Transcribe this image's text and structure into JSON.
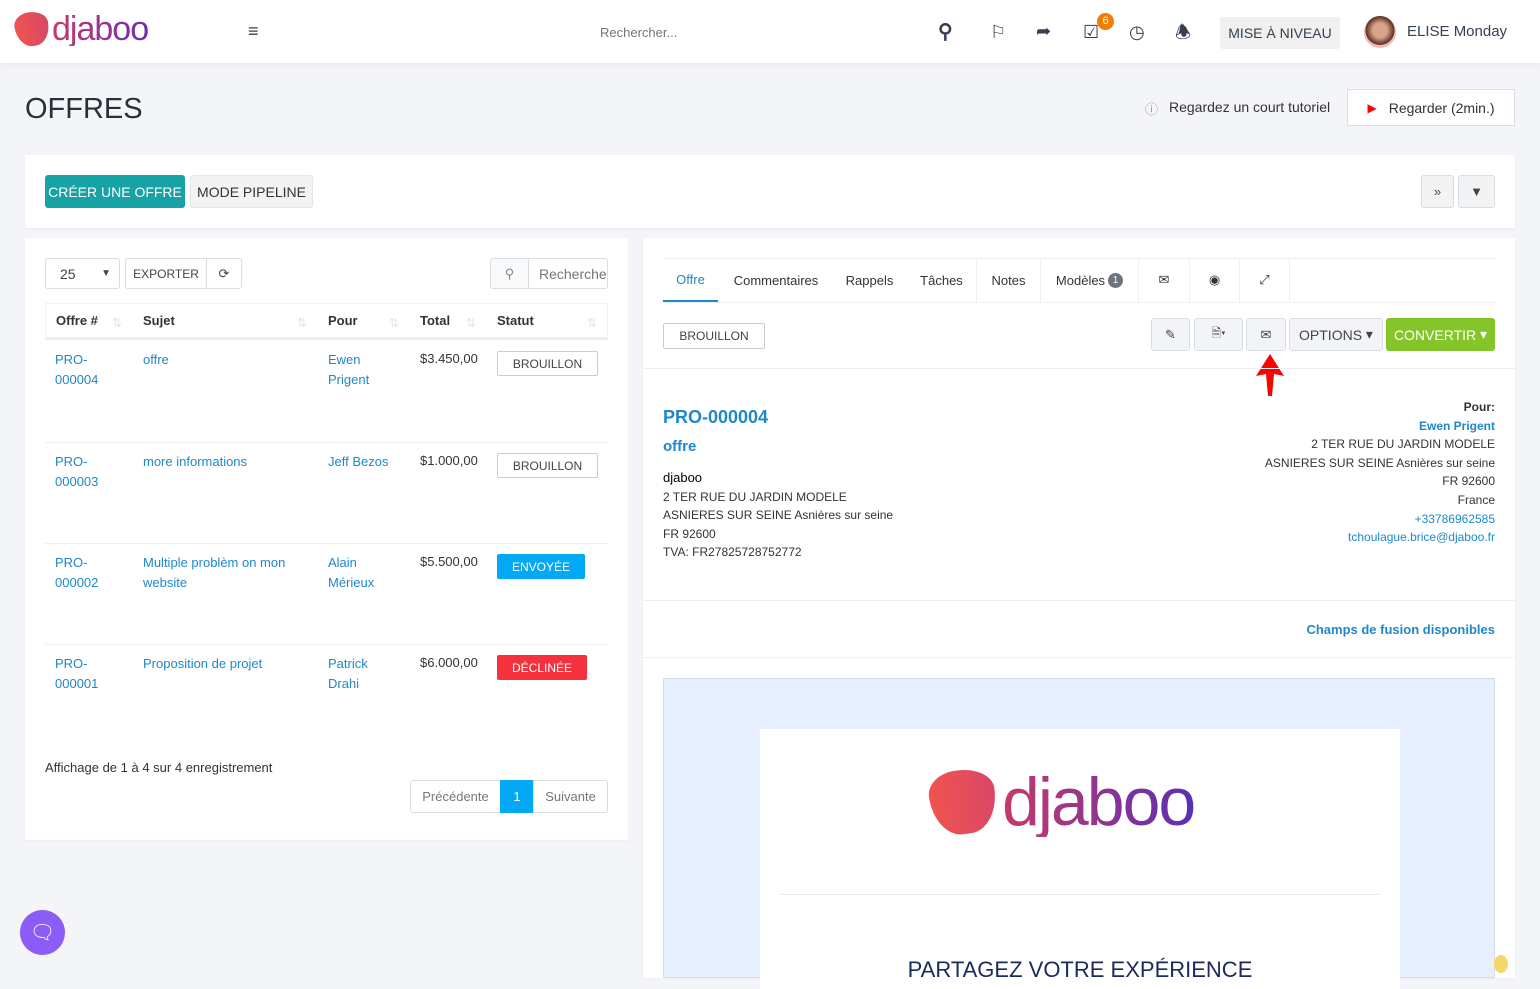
{
  "topbar": {
    "logo": "djaboo",
    "search_placeholder": "Rechercher...",
    "tasks_badge": "6",
    "upgrade_label": "MISE À NIVEAU",
    "user_name": "ELISE Monday"
  },
  "page": {
    "title": "OFFRES",
    "tutorial_text": "Regardez un court tutoriel",
    "watch_label": "Regarder (2min.)"
  },
  "toolbar": {
    "create_label": "CRÉER UNE OFFRE",
    "pipeline_label": "MODE PIPELINE"
  },
  "list": {
    "page_size": "25",
    "export_label": "EXPORTER",
    "search_placeholder": "Rechercher",
    "columns": [
      "Offre #",
      "Sujet",
      "Pour",
      "Total",
      "Statut"
    ],
    "rows": [
      {
        "id": "PRO-\n000004",
        "id1": "PRO-",
        "id2": "000004",
        "subject": "offre",
        "for1": "Ewen",
        "for2": "Prigent",
        "total": "$3.450,00",
        "status": "BROUILLON"
      },
      {
        "id1": "PRO-",
        "id2": "000003",
        "subject": "more informations",
        "for1": "Jeff Bezos",
        "for2": "",
        "total": "$1.000,00",
        "status": "BROUILLON"
      },
      {
        "id1": "PRO-",
        "id2": "000002",
        "subject": "Multiple problèm on mon website",
        "for1": "Alain",
        "for2": "Mérieux",
        "total": "$5.500,00",
        "status": "ENVOYÉE"
      },
      {
        "id1": "PRO-",
        "id2": "000001",
        "subject": "Proposition de projet",
        "for1": "Patrick",
        "for2": "Drahi",
        "total": "$6.000,00",
        "status": "DÉCLINÉE"
      }
    ],
    "info": "Affichage de 1 à 4 sur 4 enregistrement",
    "prev_label": "Précédente",
    "current_page": "1",
    "next_label": "Suivante"
  },
  "detail": {
    "tabs": [
      "Offre",
      "Commentaires",
      "Rappels",
      "Tâches",
      "Notes",
      "Modèles"
    ],
    "models_count": "1",
    "status": "BROUILLON",
    "options_label": "OPTIONS",
    "convert_label": "CONVERTIR",
    "number": "PRO-000004",
    "subject": "offre",
    "from": {
      "name": "djaboo",
      "lines": [
        "2 TER RUE DU JARDIN MODELE",
        "ASNIERES SUR SEINE Asnières sur seine",
        "FR 92600",
        "TVA: FR27825728752772"
      ]
    },
    "to": {
      "label": "Pour:",
      "name": "Ewen Prigent",
      "lines": [
        "2 TER RUE DU JARDIN MODELE",
        "ASNIERES SUR SEINE Asnières sur seine",
        "FR 92600",
        "France"
      ],
      "phone": "+33786962585",
      "email": "tchoulague.brice@djaboo.fr"
    },
    "merge_fields_link": "Champs de fusion disponibles",
    "preview": {
      "logo": "djaboo",
      "heading": "PARTAGEZ VOTRE EXPÉRIENCE"
    }
  },
  "colors": {
    "primary": "#1e88c9",
    "teal": "#17a2a6",
    "green": "#84c52a",
    "sent": "#03a9f4",
    "declined": "#f5313d"
  }
}
